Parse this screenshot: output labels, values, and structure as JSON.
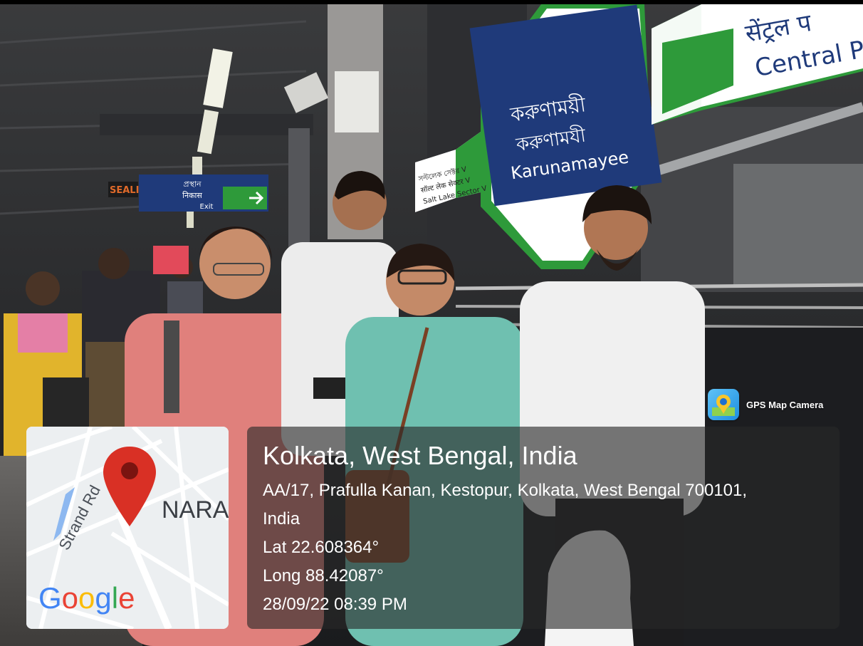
{
  "station_signs": {
    "main_bengali_1": "করুণাময়ী",
    "main_bengali_2": "করুণামযী",
    "main_english": "Karunamayee",
    "next_hindi": "सेंट्रल प",
    "next_english": "Central Pa",
    "side_line_1": "সল্টলেক সেক্টর V",
    "side_line_2": "सॉल्ट लेक सेक्टर V",
    "side_line_3": "Salt Lake Sector V",
    "exit_bengali": "প্রস্থান",
    "exit_hindi": "निकास",
    "exit_english": "Exit",
    "sealdah_partial": "SEALI"
  },
  "camera_badge": {
    "icon": "map-pin-icon",
    "label": "GPS Map Camera"
  },
  "map": {
    "road_label": "Strand Rd",
    "area_label": "NARA",
    "logo": "Google",
    "pin_color": "#d93025"
  },
  "location": {
    "city": "Kolkata, West Bengal, India",
    "address_line_1": "AA/17, Prafulla Kanan, Kestopur, Kolkata, West Bengal 700101,",
    "address_line_2": "India",
    "latitude": "Lat 22.608364°",
    "longitude": "Long 88.42087°",
    "datetime": "28/09/22 08:39 PM"
  },
  "colors": {
    "sign_blue": "#1f3a7a",
    "sign_green": "#2e9a3a",
    "panel_bg": "#282828"
  }
}
